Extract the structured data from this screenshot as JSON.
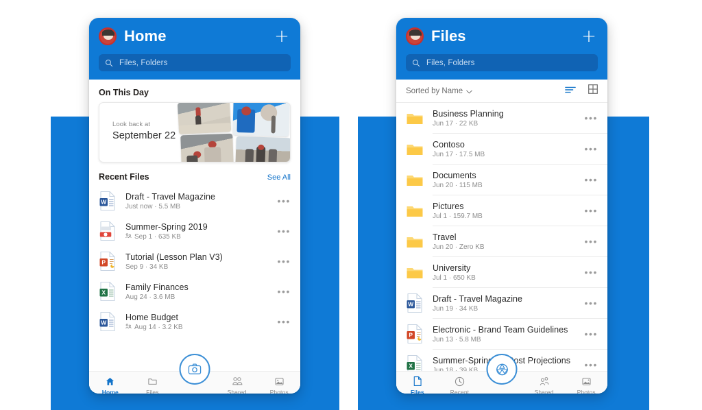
{
  "colors": {
    "brand_blue": "#0f7ad6",
    "search_blue": "#1063b4",
    "link_blue": "#1273c9",
    "folder_yellow": "#fcc947",
    "word_blue": "#2b579a",
    "excel_green": "#217346",
    "ppt_red": "#d24726"
  },
  "phone_left": {
    "header": {
      "avatar": "user-avatar",
      "title": "Home",
      "add_label": "+",
      "search_placeholder": "Files, Folders"
    },
    "on_this_day": {
      "section_title": "On This Day",
      "kicker": "Look back at",
      "date": "September 22"
    },
    "recent": {
      "section_title": "Recent Files",
      "see_all": "See All",
      "files": [
        {
          "name": "Draft - Travel Magazine",
          "meta": "Just now · 5.5 MB",
          "icon": "word-doc-icon",
          "shared": false
        },
        {
          "name": "Summer-Spring 2019",
          "meta": "Sep 1 · 635 KB",
          "icon": "video-file-icon",
          "shared": true
        },
        {
          "name": "Tutorial (Lesson Plan V3)",
          "meta": "Sep 9 · 34 KB",
          "icon": "powerpoint-doc-icon",
          "shared": false
        },
        {
          "name": "Family Finances",
          "meta": "Aug 24 · 3.6 MB",
          "icon": "excel-doc-icon",
          "shared": false
        },
        {
          "name": "Home Budget",
          "meta": "Aug 14 · 3.2 KB",
          "icon": "word-doc-icon",
          "shared": true
        }
      ]
    },
    "tabs": [
      {
        "label": "Home",
        "icon": "home-icon",
        "active": true
      },
      {
        "label": "Files",
        "icon": "folder-icon",
        "active": false
      },
      {
        "label": "Shared",
        "icon": "people-icon",
        "active": false
      },
      {
        "label": "Photos",
        "icon": "photo-icon",
        "active": false
      }
    ],
    "fab": {
      "icon": "camera-icon",
      "label": "Scan"
    }
  },
  "phone_right": {
    "header": {
      "avatar": "user-avatar",
      "title": "Files",
      "add_label": "+",
      "search_placeholder": "Files, Folders"
    },
    "sortbar": {
      "label": "Sorted by Name",
      "chevron": "chevron-down-icon",
      "list_view_icon": "list-view-icon",
      "grid_view_icon": "grid-view-icon"
    },
    "items": [
      {
        "name": "Business Planning",
        "meta": "Jun 17 · 22 KB",
        "icon": "folder-icon"
      },
      {
        "name": "Contoso",
        "meta": "Jun 17 · 17.5 MB",
        "icon": "folder-icon"
      },
      {
        "name": "Documents",
        "meta": "Jun 20 · 115 MB",
        "icon": "folder-icon"
      },
      {
        "name": "Pictures",
        "meta": "Jul 1 · 159.7 MB",
        "icon": "folder-icon"
      },
      {
        "name": "Travel",
        "meta": "Jun 20 · Zero KB",
        "icon": "folder-icon"
      },
      {
        "name": "University",
        "meta": "Jul 1 · 650 KB",
        "icon": "folder-icon"
      },
      {
        "name": "Draft - Travel Magazine",
        "meta": "Jun 19 · 34 KB",
        "icon": "word-doc-icon"
      },
      {
        "name": "Electronic - Brand Team Guidelines",
        "meta": "Jun 13 · 5.8 MB",
        "icon": "powerpoint-doc-icon"
      },
      {
        "name": "Summer-Spring 2...Cost Projections",
        "meta": "Jun 18 · 39 KB",
        "icon": "excel-doc-icon"
      }
    ],
    "tabs": [
      {
        "label": "Files",
        "icon": "file-icon",
        "active": true
      },
      {
        "label": "Recent",
        "icon": "clock-icon",
        "active": false
      },
      {
        "label": "Shared",
        "icon": "people-icon",
        "active": false
      },
      {
        "label": "Photos",
        "icon": "photo-icon",
        "active": false
      }
    ],
    "fab": {
      "icon": "camera-shutter-icon",
      "label": "Scan"
    }
  },
  "kebab": "•••"
}
